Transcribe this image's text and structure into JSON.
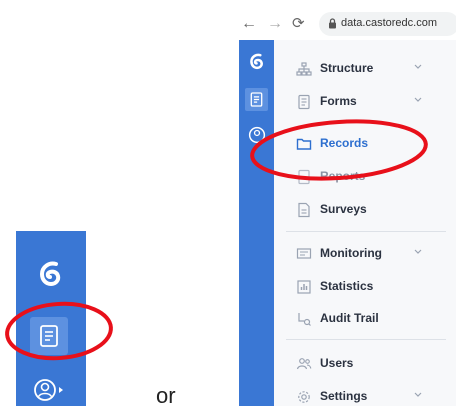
{
  "separator": {
    "text": "or"
  },
  "browser": {
    "url": "data.castoredc.com"
  },
  "menu": {
    "items": [
      {
        "key": "structure",
        "label": "Structure",
        "icon": "structure-icon",
        "chevron": true
      },
      {
        "key": "forms",
        "label": "Forms",
        "icon": "forms-icon",
        "chevron": true
      },
      {
        "key": "records",
        "label": "Records",
        "icon": "folder-icon",
        "chevron": false
      },
      {
        "key": "reports",
        "label": "Reports",
        "icon": "reports-icon",
        "chevron": false
      },
      {
        "key": "surveys",
        "label": "Surveys",
        "icon": "survey-icon",
        "chevron": false
      },
      {
        "key": "monitoring",
        "label": "Monitoring",
        "icon": "monitoring-icon",
        "chevron": true
      },
      {
        "key": "statistics",
        "label": "Statistics",
        "icon": "statistics-icon",
        "chevron": false
      },
      {
        "key": "audit",
        "label": "Audit Trail",
        "icon": "audit-trail-icon",
        "chevron": false
      },
      {
        "key": "users",
        "label": "Users",
        "icon": "users-icon",
        "chevron": false
      },
      {
        "key": "settings",
        "label": "Settings",
        "icon": "gear-icon",
        "chevron": true
      }
    ]
  },
  "colors": {
    "rail": "#3a77d4",
    "rail_highlight": "#5d91e0",
    "menu_bg": "#f7f8fa",
    "annotation": "#e8101a"
  }
}
